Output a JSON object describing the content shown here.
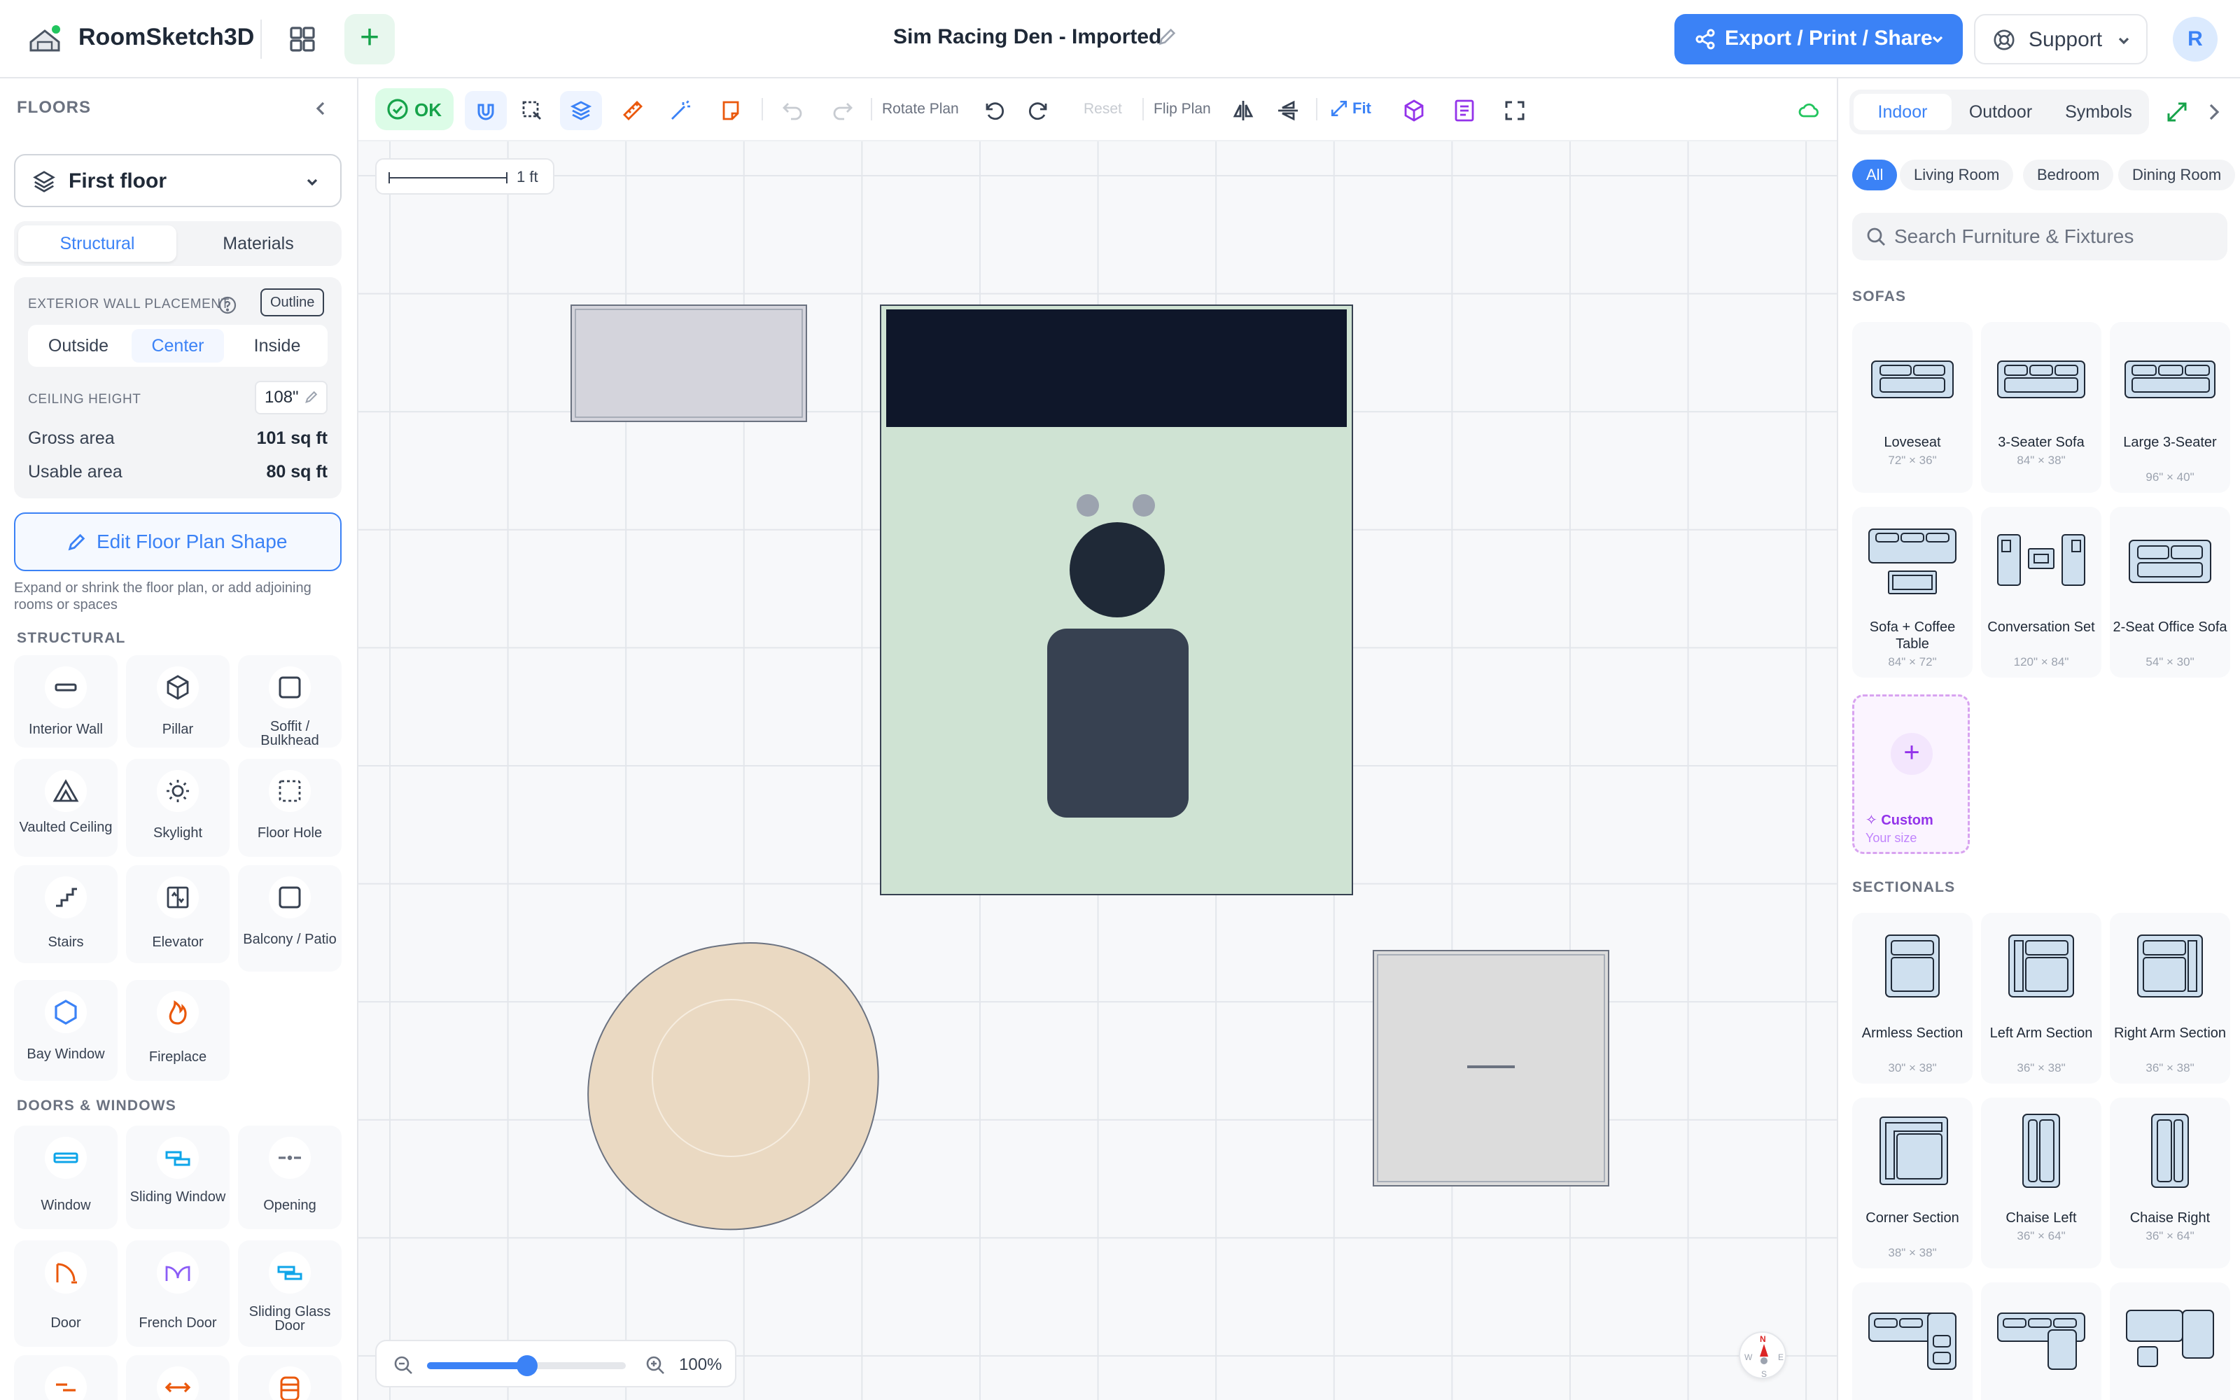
{
  "app": {
    "name": "RoomSketch3D",
    "document_title": "Sim Racing Den - Imported",
    "export_label": "Export / Print / Share",
    "support_label": "Support",
    "avatar_initial": "R"
  },
  "left_panel": {
    "header": "FLOORS",
    "floor_name": "First floor",
    "tabs": [
      "Structural",
      "Materials"
    ],
    "active_tab": "Structural",
    "exterior_wall_label": "EXTERIOR WALL PLACEMENT",
    "outline_label": "Outline",
    "wall_options": [
      "Outside",
      "Center",
      "Inside"
    ],
    "active_wall_option": "Center",
    "ceiling_label": "CEILING HEIGHT",
    "ceiling_value": "108\"",
    "gross_area_label": "Gross area",
    "gross_area_value": "101 sq ft",
    "usable_area_label": "Usable area",
    "usable_area_value": "80 sq ft",
    "edit_shape_label": "Edit Floor Plan Shape",
    "edit_shape_help": "Expand or shrink the floor plan, or add adjoining rooms or spaces",
    "structural_title": "STRUCTURAL",
    "structural_items": [
      {
        "label": "Interior Wall",
        "icon": "wall-icon"
      },
      {
        "label": "Pillar",
        "icon": "cube-icon"
      },
      {
        "label": "Soffit / Bulkhead",
        "icon": "square-icon"
      },
      {
        "label": "Vaulted Ceiling",
        "icon": "vault-icon"
      },
      {
        "label": "Skylight",
        "icon": "sun-icon"
      },
      {
        "label": "Floor Hole",
        "icon": "dashed-square-icon"
      },
      {
        "label": "Stairs",
        "icon": "stairs-icon"
      },
      {
        "label": "Elevator",
        "icon": "elevator-icon"
      },
      {
        "label": "Balcony / Patio",
        "icon": "balcony-icon"
      },
      {
        "label": "Bay Window",
        "icon": "hexagon-icon"
      },
      {
        "label": "Fireplace",
        "icon": "flame-icon"
      }
    ],
    "doors_title": "DOORS & WINDOWS",
    "door_items": [
      {
        "label": "Window",
        "icon": "window-icon"
      },
      {
        "label": "Sliding Window",
        "icon": "sliding-window-icon"
      },
      {
        "label": "Opening",
        "icon": "opening-icon"
      },
      {
        "label": "Door",
        "icon": "door-icon"
      },
      {
        "label": "French Door",
        "icon": "french-door-icon"
      },
      {
        "label": "Sliding Glass Door",
        "icon": "sliding-door-icon"
      }
    ]
  },
  "toolbar": {
    "ok_label": "OK",
    "rotate_label": "Rotate Plan",
    "reset_label": "Reset",
    "flip_label": "Flip Plan",
    "fit_label": "Fit"
  },
  "canvas": {
    "scale_label": "1 ft",
    "zoom_level": "100%",
    "zoom_fraction": 0.5,
    "compass": {
      "n": "N",
      "s": "S",
      "w": "W",
      "e": "E"
    },
    "colors": {
      "rug": "#cfe3d3",
      "screen": "#0f172a",
      "chair": "#374151",
      "head": "#1f2937",
      "ottoman": "#ead9c2",
      "side_table": "#d4d4dc",
      "cabinet": "#dcdcdc"
    }
  },
  "right_panel": {
    "tabs": [
      "Indoor",
      "Outdoor",
      "Symbols"
    ],
    "active_tab": "Indoor",
    "chips": [
      "All",
      "Living Room",
      "Bedroom",
      "Dining Room"
    ],
    "active_chip": "All",
    "search_placeholder": "Search Furniture & Fixtures",
    "sofas_title": "SOFAS",
    "sofas": [
      {
        "name": "Loveseat",
        "dims": "72\" × 36\""
      },
      {
        "name": "3-Seater Sofa",
        "dims": "84\" × 38\""
      },
      {
        "name": "Large 3-Seater",
        "dims": "96\" × 40\""
      },
      {
        "name": "Sofa + Coffee Table",
        "dims": "84\" × 72\""
      },
      {
        "name": "Conversation Set",
        "dims": "120\" × 84\""
      },
      {
        "name": "2-Seat Office Sofa",
        "dims": "54\" × 30\""
      }
    ],
    "custom_label": "Custom",
    "custom_sub": "Your size",
    "sectionals_title": "SECTIONALS",
    "sectionals": [
      {
        "name": "Armless Section",
        "dims": "30\" × 38\""
      },
      {
        "name": "Left Arm Section",
        "dims": "36\" × 38\""
      },
      {
        "name": "Right Arm Section",
        "dims": "36\" × 38\""
      },
      {
        "name": "Corner Section",
        "dims": "38\" × 38\""
      },
      {
        "name": "Chaise Left",
        "dims": "36\" × 64\""
      },
      {
        "name": "Chaise Right",
        "dims": "36\" × 64\""
      }
    ]
  }
}
